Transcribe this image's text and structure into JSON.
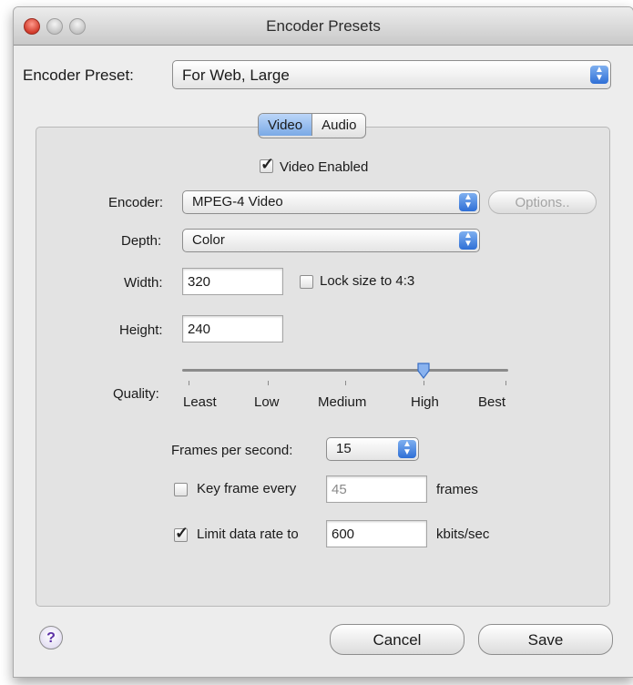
{
  "window": {
    "title": "Encoder Presets"
  },
  "preset": {
    "label": "Encoder Preset:",
    "value": "For Web, Large"
  },
  "tabs": [
    {
      "label": "Video",
      "active": true
    },
    {
      "label": "Audio",
      "active": false
    }
  ],
  "video": {
    "enabled_label": "Video Enabled",
    "enabled_checked": true,
    "encoder": {
      "label": "Encoder:",
      "value": "MPEG-4 Video",
      "options_label": "Options.."
    },
    "depth": {
      "label": "Depth:",
      "value": "Color"
    },
    "width": {
      "label": "Width:",
      "value": "320"
    },
    "lock_size": {
      "label": "Lock size to 4:3",
      "checked": false
    },
    "height": {
      "label": "Height:",
      "value": "240"
    },
    "quality": {
      "label": "Quality:",
      "levels": [
        "Least",
        "Low",
        "Medium",
        "High",
        "Best"
      ],
      "selected": "High"
    },
    "fps": {
      "label": "Frames per second:",
      "value": "15"
    },
    "keyframe": {
      "label": "Key frame every",
      "value": "45",
      "unit": "frames",
      "checked": false
    },
    "datarate": {
      "label": "Limit data rate to",
      "value": "600",
      "unit": "kbits/sec",
      "checked": true
    }
  },
  "footer": {
    "help_glyph": "?",
    "cancel_label": "Cancel",
    "save_label": "Save"
  },
  "colors": {
    "accent": "#2f6fd6",
    "window_bg": "#ededed"
  },
  "icons": [
    "close-icon",
    "minimize-icon",
    "zoom-icon",
    "stepper-icon",
    "checkmark-icon",
    "help-icon",
    "slider-thumb-icon"
  ]
}
